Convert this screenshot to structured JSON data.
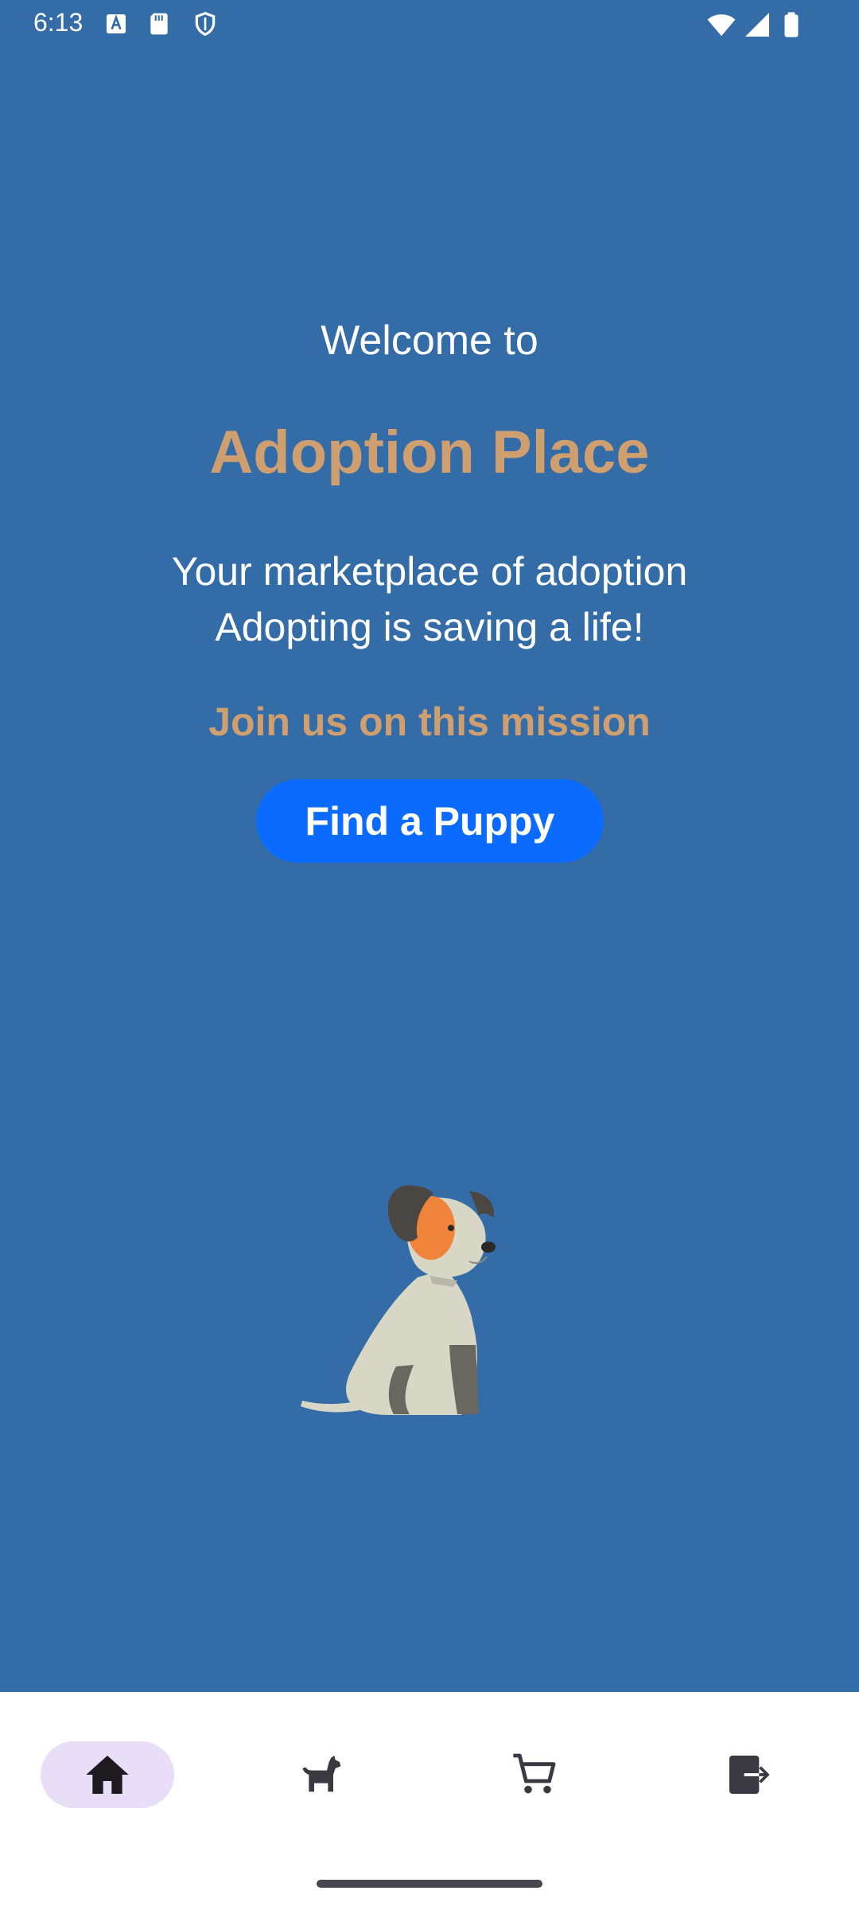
{
  "status_bar": {
    "time": "6:13",
    "left_icons": [
      "text-notification-icon",
      "sd-card-icon",
      "shield-icon"
    ],
    "right_icons": [
      "wifi-icon",
      "signal-icon",
      "battery-icon"
    ]
  },
  "main": {
    "welcome": "Welcome to",
    "app_name": "Adoption Place",
    "tagline_line1": "Your marketplace of adoption",
    "tagline_line2": "Adopting is saving a life!",
    "mission": "Join us on this mission",
    "cta_label": "Find a Puppy",
    "illustration": "sitting-puppy-illustration"
  },
  "bottom_nav": {
    "items": [
      {
        "icon": "home-icon",
        "active": true
      },
      {
        "icon": "dog-icon",
        "active": false
      },
      {
        "icon": "cart-icon",
        "active": false
      },
      {
        "icon": "logout-icon",
        "active": false
      }
    ]
  },
  "colors": {
    "background": "#336ca6",
    "accent_text": "#cf9f6f",
    "button": "#0b6aff",
    "nav_active_pill": "#e8def8",
    "nav_icon": "#1d1b20"
  }
}
